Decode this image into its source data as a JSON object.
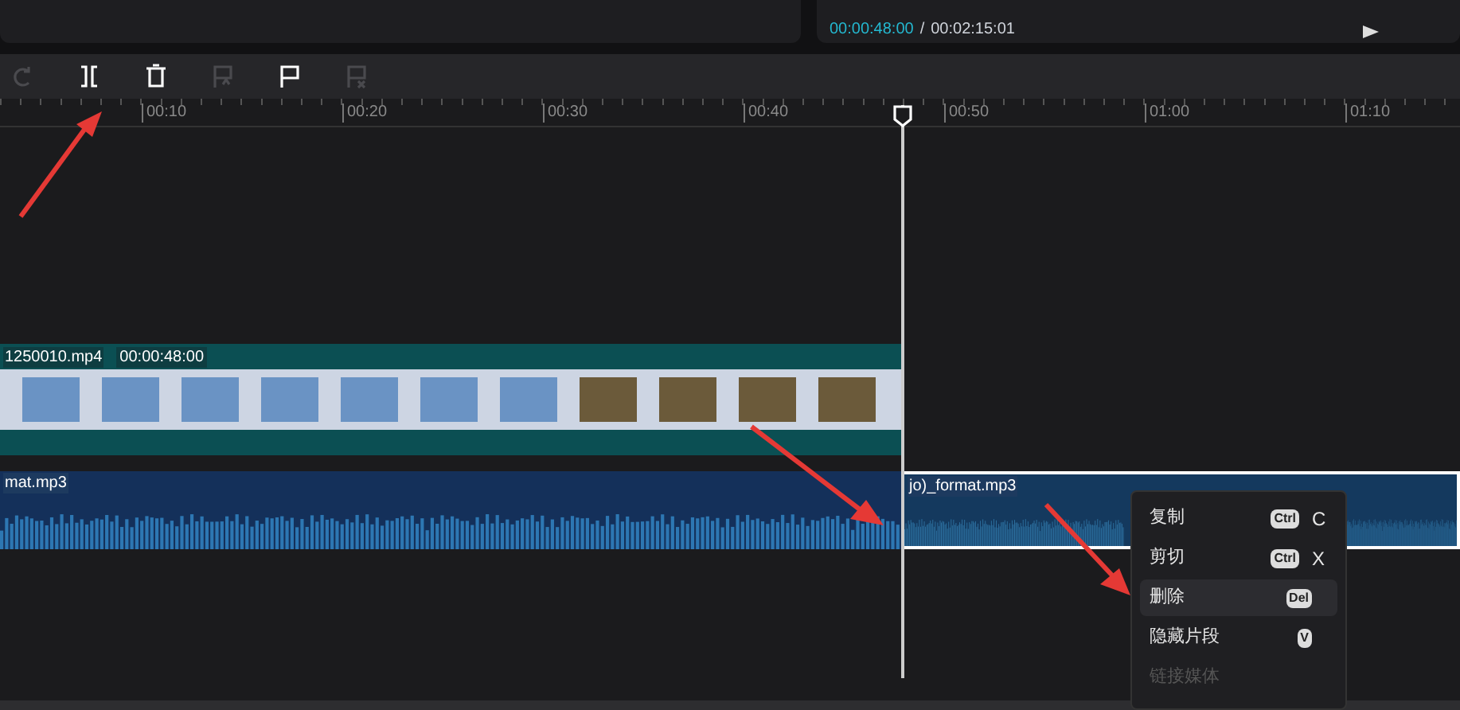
{
  "player": {
    "current_time": "00:00:48:00",
    "separator": "/",
    "total_time": "00:02:15:01"
  },
  "toolbar": [
    {
      "kind": "redo",
      "disabled": true
    },
    {
      "kind": "split",
      "disabled": false
    },
    {
      "kind": "delete",
      "disabled": false
    },
    {
      "kind": "flag-ai",
      "disabled": true
    },
    {
      "kind": "flag",
      "disabled": false
    },
    {
      "kind": "flag-x",
      "disabled": true
    }
  ],
  "ruler": [
    "00:10",
    "00:20",
    "00:30",
    "00:40",
    "00:50",
    "01:00",
    "01:10"
  ],
  "video_clip": {
    "name": "1250010.mp4",
    "duration": "00:00:48:00"
  },
  "audio_clips": [
    {
      "name": "mat.mp3",
      "selected": false
    },
    {
      "name": "jo)_format.mp3",
      "selected": true
    }
  ],
  "context_menu": [
    {
      "label": "复制",
      "modifier": "Ctrl",
      "key": "C",
      "selected": false,
      "disabled": false
    },
    {
      "label": "剪切",
      "modifier": "Ctrl",
      "key": "X",
      "selected": false,
      "disabled": false
    },
    {
      "label": "删除",
      "key": "Del",
      "selected": true,
      "disabled": false
    },
    {
      "label": "隐藏片段",
      "key": "V",
      "selected": false,
      "disabled": false
    },
    {
      "label": "链接媒体",
      "selected": false,
      "disabled": true
    }
  ]
}
